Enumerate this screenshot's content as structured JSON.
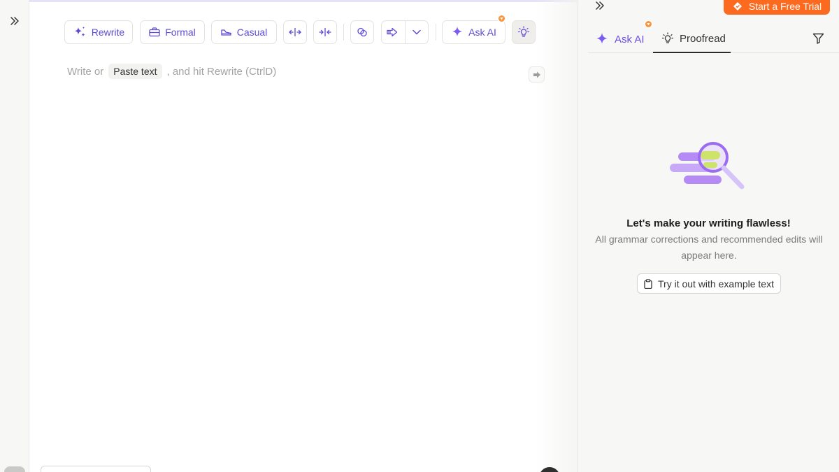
{
  "toolbar": {
    "rewrite": "Rewrite",
    "formal": "Formal",
    "casual": "Casual",
    "ask_ai": "Ask AI"
  },
  "editor": {
    "placeholder_before": "Write or",
    "paste_chip": "Paste text",
    "placeholder_after": ", and hit Rewrite (CtrlD)"
  },
  "panel": {
    "trial_button": "Start a Free Trial",
    "tabs": [
      {
        "label": "Ask AI"
      },
      {
        "label": "Proofread"
      }
    ],
    "empty_title": "Let's make your writing flawless!",
    "empty_description": "All grammar corrections and recommended edits will appear here.",
    "example_button": "Try it out with example text"
  },
  "colors": {
    "accent": "#5b4bd6",
    "trial": "#fb6a1e",
    "badge": "#fb923c"
  }
}
